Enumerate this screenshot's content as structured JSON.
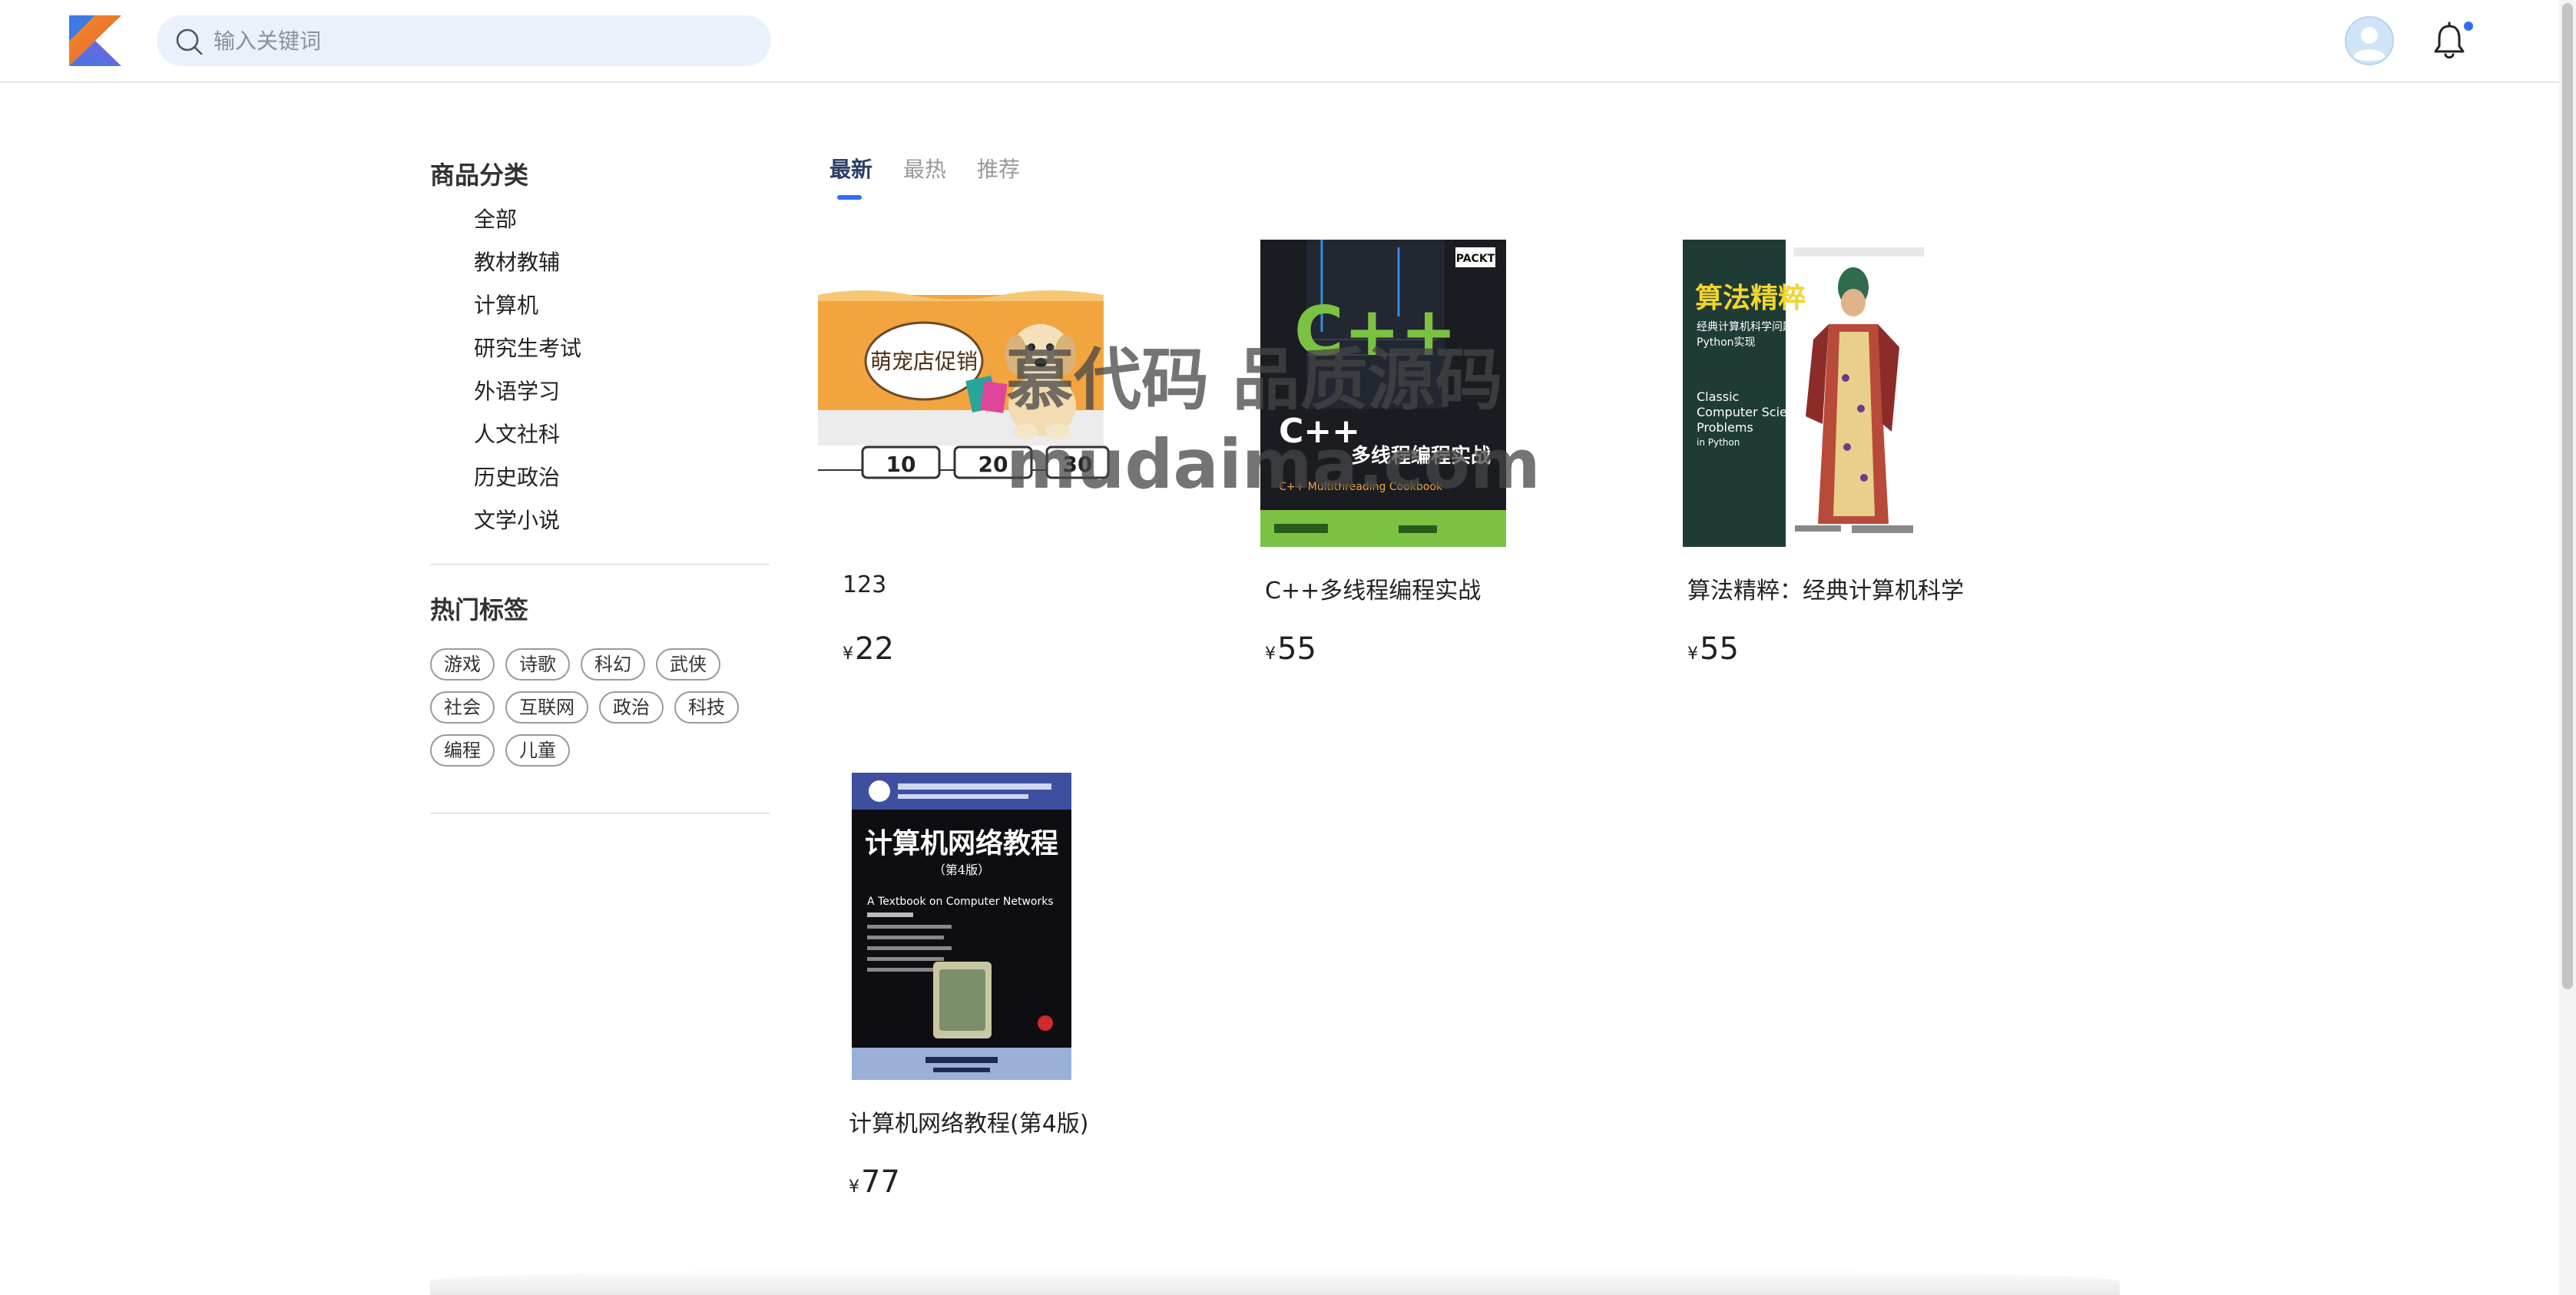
{
  "header": {
    "search_placeholder": "输入关键词",
    "icons": [
      "kotlin-logo-icon",
      "search-icon",
      "user-avatar-icon",
      "bell-icon"
    ],
    "accent_color": "#2f6df6"
  },
  "sidebar": {
    "category_title": "商品分类",
    "categories": [
      "全部",
      "教材教辅",
      "计算机",
      "研究生考试",
      "外语学习",
      "人文社科",
      "历史政治",
      "文学小说"
    ],
    "tags_title": "热门标签",
    "tags": [
      "游戏",
      "诗歌",
      "科幻",
      "武侠",
      "社会",
      "互联网",
      "政治",
      "科技",
      "编程",
      "儿童"
    ]
  },
  "tabs": [
    {
      "label": "最新",
      "active": true
    },
    {
      "label": "最热",
      "active": false
    },
    {
      "label": "推荐",
      "active": false
    }
  ],
  "products": [
    {
      "title": "123",
      "currency": "¥",
      "price": "22"
    },
    {
      "title": "C++多线程编程实战",
      "currency": "¥",
      "price": "55"
    },
    {
      "title": "算法精粹：经典计算机科学",
      "currency": "¥",
      "price": "55"
    },
    {
      "title": "计算机网络教程(第4版)",
      "currency": "¥",
      "price": "77"
    }
  ],
  "covers": {
    "promo": {
      "sign_text": "萌宠店促销",
      "tiles": [
        "10",
        "20",
        "30"
      ]
    },
    "cpp": {
      "big_title": "C++",
      "subtitle": "C++",
      "cn_title": "多线程编程实战",
      "en_title": "C++ Multithreading Cookbook",
      "publisher_badge": "PACKT"
    },
    "algo": {
      "cn_title": "算法精粹",
      "cn_subtitle": "经典计算机科学问题的",
      "cn_subtitle2": "Python实现",
      "en_title1": "Classic",
      "en_title2": "Computer Science",
      "en_title3": "Problems",
      "en_title4": "in Python"
    },
    "network": {
      "cn_title": "计算机网络教程",
      "edition": "（第4版）",
      "en_title": "A Textbook on Computer Networks"
    }
  },
  "watermark": {
    "line1": "慕代码 品质源码",
    "line2": "mudaima.com"
  }
}
